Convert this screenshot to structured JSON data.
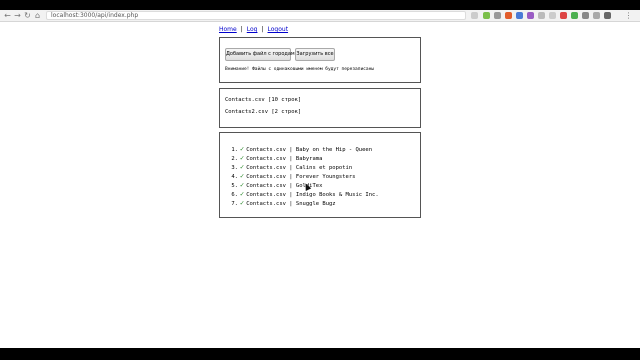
{
  "browser": {
    "url": "localhost:3000/api/index.php",
    "back_icon": "back-arrow",
    "forward_icon": "forward-arrow",
    "reload_icon": "reload",
    "home_icon": "home"
  },
  "nav": {
    "links": [
      "Home",
      "Log",
      "Logout"
    ],
    "separator": "|"
  },
  "upload_panel": {
    "add_button": "Добавить файл с городами",
    "upload_button": "Загрузить все",
    "warning": "Внимание! Файлы с одинаковыми именем будут перезаписаны"
  },
  "files": [
    "Contacts.csv [10 строк]",
    "Contacts2.csv [2 строк]"
  ],
  "results": [
    {
      "num": "1.",
      "text": "Contacts.csv | Baby on the Hip - Queen"
    },
    {
      "num": "2.",
      "text": "Contacts.csv | Babyrama"
    },
    {
      "num": "3.",
      "text": "Contacts.csv | Calins et popotin"
    },
    {
      "num": "4.",
      "text": "Contacts.csv | Forever Youngsters"
    },
    {
      "num": "5.",
      "text": "Contacts.csv | GoldiTex"
    },
    {
      "num": "6.",
      "text": "Contacts.csv | Indigo Books & Music Inc."
    },
    {
      "num": "7.",
      "text": "Contacts.csv | Snuggle Bugz"
    }
  ],
  "check_mark": "✓",
  "colors": {
    "check": "#2a8a2a",
    "link": "#0000cc"
  }
}
